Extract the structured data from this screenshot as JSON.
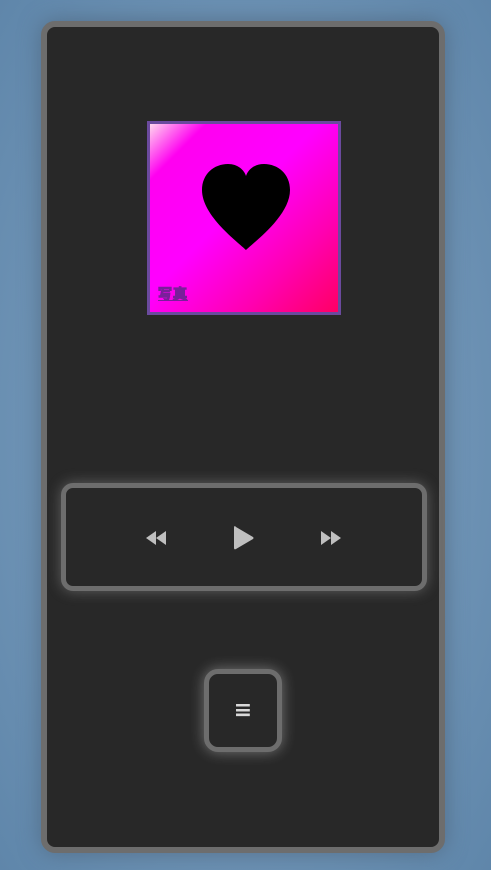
{
  "player": {
    "album_art": {
      "icon": "heart-icon",
      "mark_text": "写真",
      "colors": {
        "gradient_start": "#ffd6ee",
        "gradient_mid": "#ff00ff",
        "gradient_end": "#ff0064",
        "border": "#6b4a9e",
        "heart": "#000000"
      }
    },
    "controls": {
      "rewind_icon": "rewind-icon",
      "play_icon": "play-icon",
      "fast_forward_icon": "fast-forward-icon"
    },
    "menu": {
      "icon": "menu-icon",
      "glyph": "≡"
    }
  },
  "colors": {
    "page_background": "#6e93b5",
    "device_body": "#282828",
    "device_border": "#6d6d6d",
    "icon": "#bfbfbf"
  }
}
